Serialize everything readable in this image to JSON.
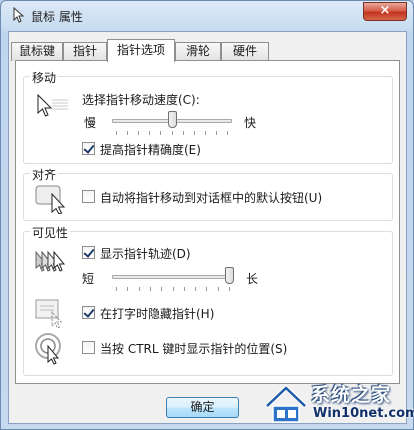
{
  "window": {
    "title": "鼠标 属性",
    "close_symbol": "×"
  },
  "tabs": [
    {
      "label": "鼠标键",
      "active": false
    },
    {
      "label": "指针",
      "active": false
    },
    {
      "label": "指针选项",
      "active": true
    },
    {
      "label": "滑轮",
      "active": false
    },
    {
      "label": "硬件",
      "active": false
    }
  ],
  "motion": {
    "group_label": "移动",
    "speed_label": "选择指针移动速度(C):",
    "slow_label": "慢",
    "fast_label": "快",
    "speed_level": 0.5,
    "precision_label": "提高指针精确度(E)",
    "precision_checked": true
  },
  "snap_to": {
    "group_label": "对齐",
    "default_button_label": "自动将指针移动到对话框中的默认按钮(U)",
    "default_button_checked": false
  },
  "visibility": {
    "group_label": "可见性",
    "trails_label": "显示指针轨迹(D)",
    "trails_checked": true,
    "short_label": "短",
    "long_label": "长",
    "trails_level": 1.0,
    "hide_typing_label": "在打字时隐藏指针(H)",
    "hide_typing_checked": true,
    "ctrl_label": "当按 CTRL 键时显示指针的位置(S)",
    "ctrl_checked": false
  },
  "buttons": {
    "ok": "确定"
  },
  "watermark": {
    "line1": "系统之家",
    "line2": "Win10net.com"
  },
  "icons": {
    "title": "mouse-pointer-icon",
    "motion": "pointer-speed-icon",
    "snap": "snap-to-button-icon",
    "trails": "pointer-trails-icon",
    "hide": "hide-pointer-icon",
    "ctrl": "ctrl-locate-icon"
  }
}
